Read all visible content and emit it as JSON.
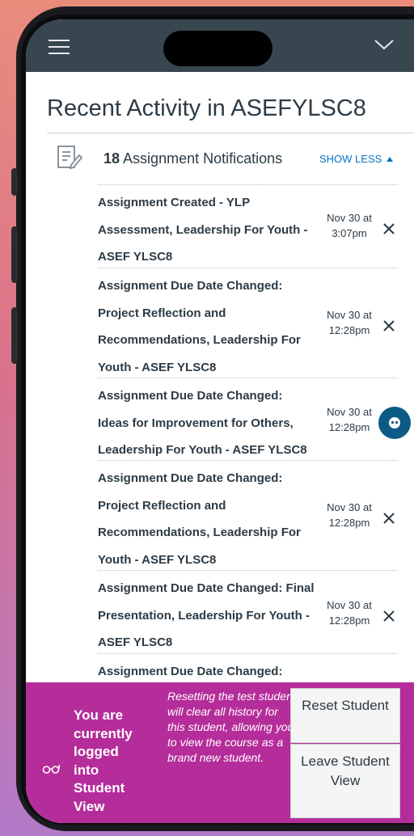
{
  "page_title": "Recent Activity in ASEFYLSC8",
  "notifications": {
    "count": "18",
    "label": "Assignment Notifications",
    "toggle_label": "SHOW LESS"
  },
  "items": [
    {
      "text": "Assignment Created - YLP Assessment, Leadership For Youth - ASEF YLSC8",
      "date_line1": "Nov 30 at",
      "date_line2": "3:07pm"
    },
    {
      "text": "Assignment Due Date Changed: Project Reflection and Recommendations, Leadership For Youth - ASEF YLSC8",
      "date_line1": "Nov 30 at",
      "date_line2": "12:28pm"
    },
    {
      "text": "Assignment Due Date Changed: Ideas for Improvement for Others, Leadership For Youth - ASEF YLSC8",
      "date_line1": "Nov 30 at",
      "date_line2": "12:28pm"
    },
    {
      "text": "Assignment Due Date Changed: Project Reflection and Recommendations, Leadership For Youth - ASEF YLSC8",
      "date_line1": "Nov 30 at",
      "date_line2": "12:28pm"
    },
    {
      "text": "Assignment Due Date Changed: Final Presentation, Leadership For Youth - ASEF YLSC8",
      "date_line1": "Nov 30 at",
      "date_line2": "12:28pm"
    },
    {
      "text": "Assignment Due Date Changed:",
      "date_line1": "",
      "date_line2": ""
    }
  ],
  "student_view": {
    "status_text": "You are currently logged into Student View",
    "info_text": "Resetting the test student will clear all history for this student, allowing you to view the course as a brand new student.",
    "reset_label": "Reset Student",
    "leave_label": "Leave Student View"
  },
  "colors": {
    "topbar": "#384650",
    "link": "#0774c6",
    "footer": "#b52d9a",
    "text": "#2d3b45"
  },
  "icons": {
    "menu": "hamburger-icon",
    "collapse": "chevron-down-icon",
    "notification": "assignment-icon",
    "dismiss": "close-icon",
    "help": "help-bubble-icon",
    "student_view": "glasses-icon"
  }
}
